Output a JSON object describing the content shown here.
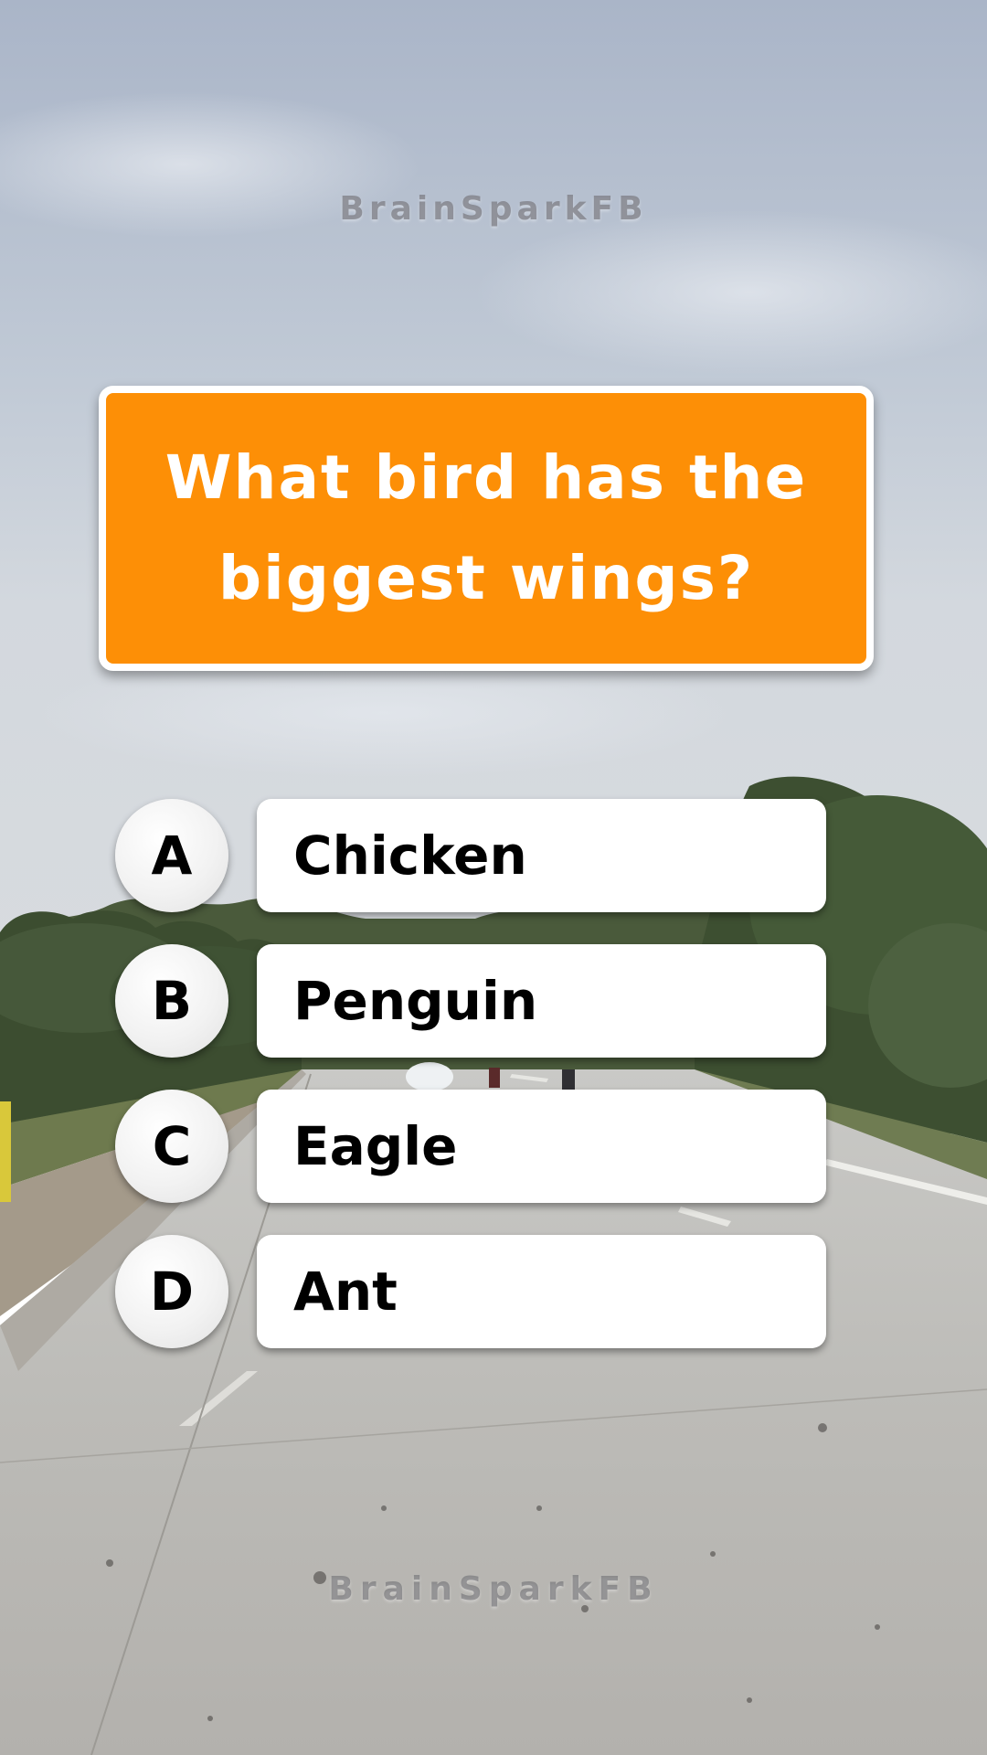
{
  "watermark": {
    "top": "BrainSparkFB",
    "bottom": "BrainSparkFB"
  },
  "question": {
    "text": "What bird has the biggest wings?"
  },
  "options": [
    {
      "letter": "A",
      "answer": "Chicken"
    },
    {
      "letter": "B",
      "answer": "Penguin"
    },
    {
      "letter": "C",
      "answer": "Eagle"
    },
    {
      "letter": "D",
      "answer": "Ant"
    }
  ],
  "colors": {
    "question_background": "#fd8f06",
    "question_text": "#ffffff",
    "option_background": "#ffffff",
    "option_text": "#000000"
  }
}
